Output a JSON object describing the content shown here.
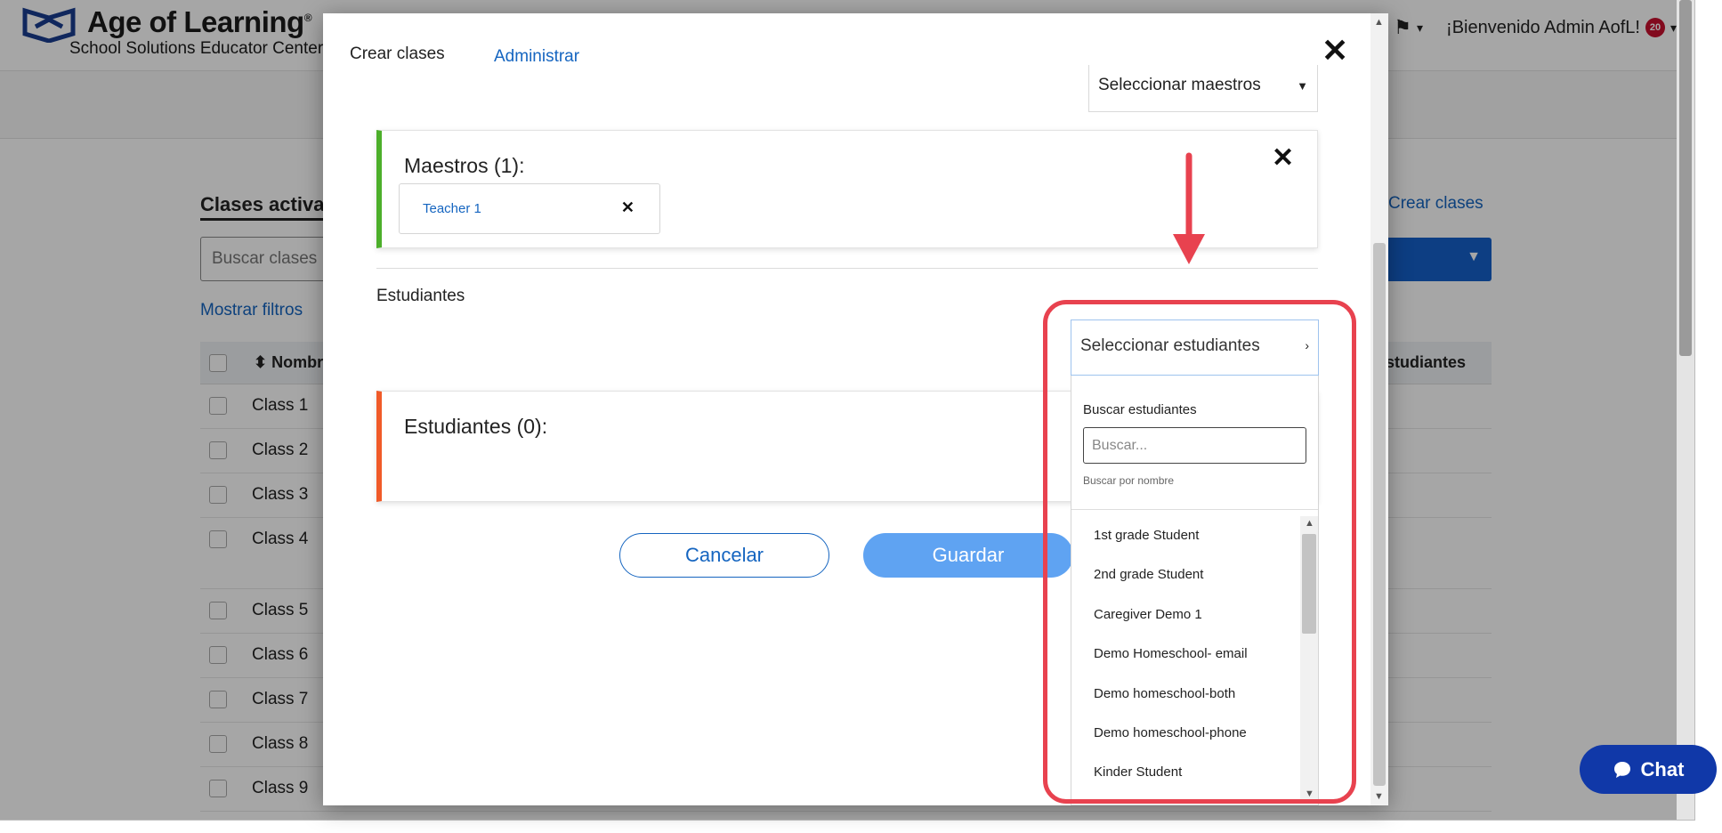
{
  "header": {
    "logo_title": "Age of Learning",
    "logo_trademark": "®",
    "logo_subtitle": "School Solutions Educator Center",
    "welcome": "¡Bienvenido Admin AofL!",
    "notification_count": "20"
  },
  "background": {
    "section_title": "Clases activas",
    "search_placeholder": "Buscar clases",
    "show_filters": "Mostrar filtros",
    "create_link": "Crear clases",
    "col_name": "Nombre",
    "col_right": "Estudiantes",
    "rows": [
      "Class 1",
      "Class 2",
      "Class 3",
      "Class 4",
      "Class 5",
      "Class 6",
      "Class 7",
      "Class 8",
      "Class 9"
    ]
  },
  "modal": {
    "tab_create": "Crear clases",
    "tab_admin": "Administrar",
    "select_teachers": "Seleccionar maestros",
    "teachers_title": "Maestros (1):",
    "teacher_chip": "Teacher 1",
    "students_label": "Estudiantes",
    "students_title": "Estudiantes (0):",
    "cancel": "Cancelar",
    "save": "Guardar"
  },
  "student_dropdown": {
    "trigger": "Seleccionar estudiantes",
    "search_label": "Buscar estudiantes",
    "search_placeholder": "Buscar...",
    "search_hint": "Buscar por nombre",
    "options": [
      "1st grade Student",
      "2nd grade Student",
      "Caregiver Demo 1",
      "Demo Homeschool- email",
      "Demo homeschool-both",
      "Demo homeschool-phone",
      "Kinder Student"
    ]
  },
  "chat": {
    "label": "Chat"
  },
  "colors": {
    "brand_blue": "#1565c0",
    "save_blue": "#5fa3f2",
    "teachers_accent": "#4caf2a",
    "students_accent": "#f05a28",
    "annotation_red": "#e8424f",
    "chat_bg": "#1038a8"
  }
}
